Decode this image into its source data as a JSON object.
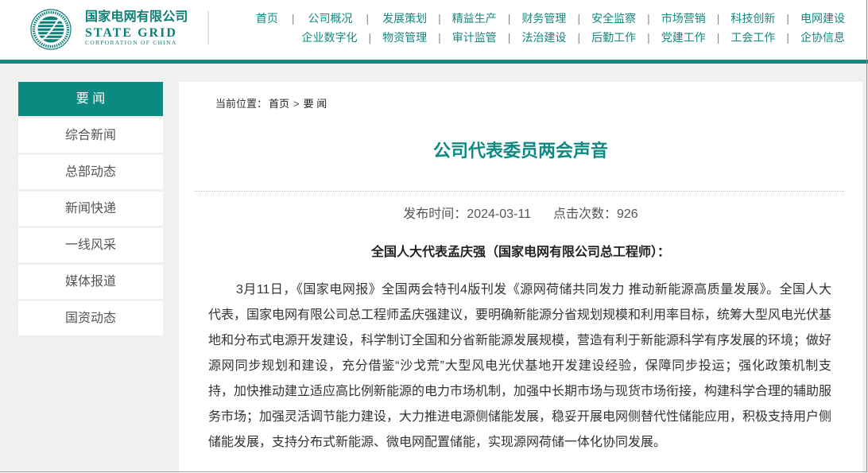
{
  "logo": {
    "name_cn": "国家电网有限公司",
    "name_en": "STATE GRID",
    "name_en_sub": "CORPORATION OF CHINA"
  },
  "nav": {
    "separator": "|",
    "row1": [
      "首页",
      "公司概况",
      "发展策划",
      "精益生产",
      "财务管理",
      "安全监察",
      "市场营销",
      "科技创新",
      "电网建设"
    ],
    "row2": [
      "企业数字化",
      "物资管理",
      "审计监管",
      "法治建设",
      "后勤工作",
      "党建工作",
      "工会工作",
      "企协信息"
    ]
  },
  "sidebar": {
    "active": "要 闻",
    "items": [
      "综合新闻",
      "总部动态",
      "新闻快递",
      "一线风采",
      "媒体报道",
      "国资动态"
    ]
  },
  "breadcrumb": {
    "label": "当前位置：",
    "home": "首页",
    "separator": ">",
    "current": "要 闻"
  },
  "article": {
    "title": "公司代表委员两会声音",
    "publish_label": "发布时间：",
    "publish_date": "2024-03-11",
    "views_label": "点击次数：",
    "views": "926",
    "subheading": "全国人大代表孟庆强（国家电网有限公司总工程师）：",
    "paragraph_lines": [
      "3月11日，《国家电网报》全国两会特刊4版刊发《源网荷储共同发力 推动新能源高质量发展》。全国人大",
      "代表，国家电网有限公司总工程师孟庆强建议，要明确新能源分省规划规模和利用率目标，统筹大型风电光伏基",
      "地和分布式电源开发建设，科学制订全国和分省新能源发展规模，营造有利于新能源科学有序发展的环境；做好",
      "源网同步规划和建设，充分借鉴“沙戈荒”大型风电光伏基地开发建设经验，保障同步投运；强化政策机制支",
      "持，加快推动建立适应高比例新能源的电力市场机制，加强中长期市场与现货市场衔接，构建科学合理的辅助服",
      "务市场；加强灵活调节能力建设，大力推进电源侧储能发展，稳妥开展电网侧替代性储能应用，积极支持用户侧",
      "储能发展，支持分布式新能源、微电网配置储能，实现源网荷储一体化协同发展。"
    ]
  },
  "colors": {
    "brand": "#0c8a82",
    "logo": "#0a7f78",
    "nav_text": "#14897f",
    "title": "#0f8a83",
    "background": "#eff0f0"
  }
}
